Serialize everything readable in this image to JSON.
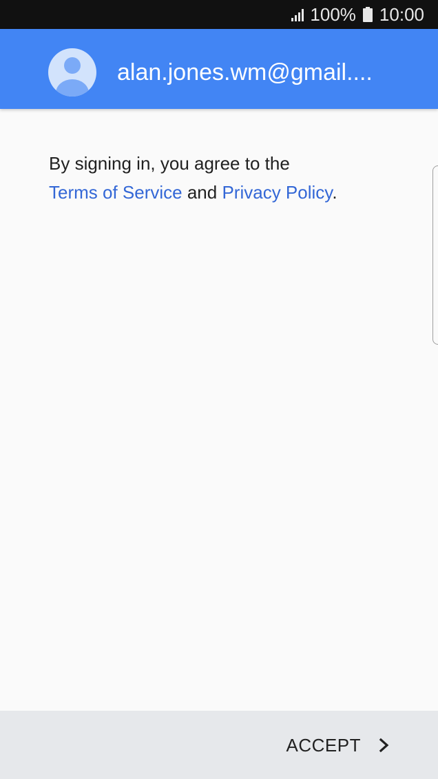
{
  "status_bar": {
    "battery_percent": "100%",
    "time": "10:00",
    "icons": [
      "signal-icon",
      "battery-icon"
    ]
  },
  "header": {
    "email": "alan.jones.wm@gmail....",
    "avatar_icon": "avatar-icon"
  },
  "terms": {
    "line1": "By signing in, you agree to the",
    "tos_link": "Terms of Service",
    "and_text": "and",
    "privacy_link": "Privacy Policy",
    "period": "."
  },
  "bottom": {
    "accept_label": "ACCEPT",
    "icon": "chevron-right-icon"
  },
  "colors": {
    "header": "#4285f4",
    "link": "#3367d6",
    "status_bar": "#111111",
    "bottom_bar": "#e6e8eb",
    "background": "#fafafa"
  }
}
